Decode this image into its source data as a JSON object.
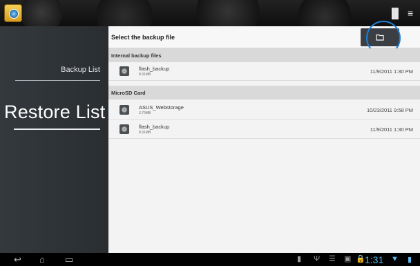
{
  "sidebar": {
    "backup_list": "Backup List",
    "restore_list": "Restore List"
  },
  "main": {
    "title": "Select the backup file",
    "sections": [
      {
        "title": "Internal backup files",
        "files": [
          {
            "name": "flash_backup",
            "size": "8.91MB",
            "date": "11/9/2011 1:30 PM"
          }
        ]
      },
      {
        "title": "MicroSD Card",
        "files": [
          {
            "name": "ASUS_Webstorage",
            "size": "3.70MB",
            "date": "10/23/2011 9:58 PM"
          },
          {
            "name": "flash_backup",
            "size": "8.91MB",
            "date": "11/9/2011 1:30 PM"
          }
        ]
      }
    ]
  },
  "statusbar": {
    "time": "1:31"
  },
  "icons": {
    "app": "app-icon",
    "folder": "folder-icon",
    "back": "back-icon",
    "home": "home-icon",
    "recent": "recent-apps-icon"
  },
  "colors": {
    "accent_ring": "#1e7fd6",
    "clock": "#5fb7ea"
  }
}
